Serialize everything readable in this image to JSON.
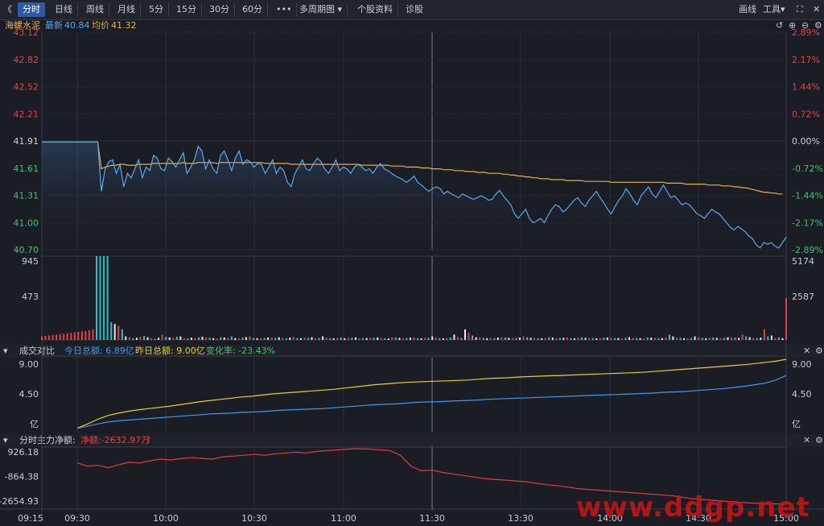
{
  "toolbar": {
    "back": "《",
    "tabs": [
      "分时",
      "日线",
      "周线",
      "月线",
      "5分",
      "15分",
      "30分",
      "60分"
    ],
    "more": "•••",
    "multi_period": "多周期图",
    "stock_info": "个股资料",
    "diagnose": "诊股",
    "right": [
      "画线",
      "工具"
    ]
  },
  "header": {
    "name": "海螺水泥",
    "latest_label": "最新",
    "latest_value": "40.84",
    "avg_label": "均价",
    "avg_value": "41.32"
  },
  "panel2": {
    "title": "成交对比",
    "today": "今日总额: 6.89亿",
    "yesterday": "昨日总额: 9.00亿",
    "change": "变化率: -23.43%"
  },
  "panel3": {
    "title": "分时主力净额:",
    "net": "净额:-2632.97万"
  },
  "watermark": "www.ddgp.net",
  "colors": {
    "price": "#5aa8e8",
    "avg": "#e8b040",
    "up": "#e84040",
    "down": "#3cc46a",
    "cyan": "#28c0c8",
    "today": "#3a9af0",
    "yesterday": "#e8d020",
    "flow": "#e03c3c"
  },
  "chart_data": [
    {
      "type": "line",
      "title": "海螺水泥",
      "x_ticks": [
        "09:15",
        "09:30",
        "10:00",
        "10:30",
        "11:00",
        "11:30",
        "13:30",
        "14:00",
        "14:30",
        "15:00"
      ],
      "y_left_ticks": [
        "43.12",
        "42.82",
        "42.52",
        "42.21",
        "41.91",
        "41.61",
        "41.31",
        "41.00",
        "40.70"
      ],
      "y_right_ticks": [
        "2.89%",
        "2.17%",
        "1.44%",
        "0.72%",
        "0.00%",
        "-0.72%",
        "-1.44%",
        "-2.17%",
        "-2.89%"
      ],
      "ylim": [
        40.7,
        43.12
      ],
      "prev_close": 41.91,
      "series": [
        {
          "name": "最新",
          "values": [
            41.9,
            41.9,
            41.9,
            41.9,
            41.9,
            41.9,
            41.9,
            41.9,
            41.9,
            41.9,
            41.9,
            41.9,
            41.9,
            41.9,
            41.9,
            41.9,
            41.35,
            41.6,
            41.68,
            41.7,
            41.55,
            41.65,
            41.4,
            41.55,
            41.5,
            41.6,
            41.7,
            41.5,
            41.62,
            41.58,
            41.75,
            41.72,
            41.6,
            41.58,
            41.72,
            41.68,
            41.62,
            41.7,
            41.78,
            41.55,
            41.62,
            41.7,
            41.85,
            41.8,
            41.6,
            41.7,
            41.6,
            41.55,
            41.75,
            41.8,
            41.7,
            41.58,
            41.72,
            41.8,
            41.65,
            41.7,
            41.68,
            41.62,
            41.66,
            41.65,
            41.55,
            41.62,
            41.7,
            41.55,
            41.62,
            41.58,
            41.45,
            41.4,
            41.55,
            41.62,
            41.7,
            41.6,
            41.58,
            41.66,
            41.72,
            41.68,
            41.6,
            41.55,
            41.62,
            41.7,
            41.58,
            41.62,
            41.6,
            41.55,
            41.62,
            41.65,
            41.62,
            41.58,
            41.6,
            41.55,
            41.62,
            41.66,
            41.6,
            41.58,
            41.55,
            41.52,
            41.5,
            41.48,
            41.45,
            41.48,
            41.52,
            41.45,
            41.42,
            41.38,
            41.35,
            41.38,
            41.4,
            41.38,
            41.32,
            41.35,
            41.32,
            41.3,
            41.28,
            41.32,
            41.3,
            41.28,
            41.26,
            41.28,
            41.3,
            41.28,
            41.25,
            41.26,
            41.32,
            41.36,
            41.3,
            41.25,
            41.2,
            41.1,
            41.05,
            41.1,
            41.15,
            41.05,
            41.0,
            41.02,
            41.05,
            41.0,
            41.08,
            41.15,
            41.2,
            41.18,
            41.12,
            41.15,
            41.2,
            41.25,
            41.28,
            41.22,
            41.18,
            41.25,
            41.3,
            41.35,
            41.28,
            41.22,
            41.15,
            41.1,
            41.18,
            41.25,
            41.3,
            41.38,
            41.32,
            41.25,
            41.2,
            41.3,
            41.35,
            41.4,
            41.32,
            41.28,
            41.35,
            41.42,
            41.35,
            41.28,
            41.3,
            41.25,
            41.2,
            41.22,
            41.2,
            41.15,
            41.1,
            41.08,
            41.05,
            41.1,
            41.15,
            41.12,
            41.1,
            41.05,
            41.0,
            40.95,
            40.92,
            40.96,
            40.93,
            40.9,
            40.85,
            40.82,
            40.75,
            40.72,
            40.78,
            40.76,
            40.78,
            40.74,
            40.72,
            40.78,
            40.84
          ]
        },
        {
          "name": "均价",
          "values": [
            41.9,
            41.9,
            41.9,
            41.9,
            41.9,
            41.9,
            41.9,
            41.9,
            41.9,
            41.9,
            41.9,
            41.9,
            41.9,
            41.9,
            41.9,
            41.9,
            41.6,
            41.62,
            41.63,
            41.64,
            41.64,
            41.65,
            41.65,
            41.64,
            41.64,
            41.64,
            41.65,
            41.65,
            41.65,
            41.65,
            41.66,
            41.66,
            41.66,
            41.66,
            41.66,
            41.66,
            41.66,
            41.66,
            41.67,
            41.66,
            41.66,
            41.66,
            41.67,
            41.67,
            41.67,
            41.67,
            41.67,
            41.66,
            41.67,
            41.67,
            41.67,
            41.67,
            41.67,
            41.67,
            41.67,
            41.67,
            41.67,
            41.67,
            41.67,
            41.67,
            41.66,
            41.66,
            41.66,
            41.66,
            41.66,
            41.66,
            41.66,
            41.65,
            41.65,
            41.65,
            41.65,
            41.65,
            41.65,
            41.65,
            41.65,
            41.65,
            41.65,
            41.65,
            41.65,
            41.65,
            41.65,
            41.65,
            41.65,
            41.65,
            41.65,
            41.65,
            41.64,
            41.64,
            41.64,
            41.64,
            41.64,
            41.64,
            41.64,
            41.64,
            41.63,
            41.63,
            41.63,
            41.63,
            41.62,
            41.62,
            41.62,
            41.62,
            41.61,
            41.61,
            41.61,
            41.6,
            41.6,
            41.6,
            41.59,
            41.59,
            41.59,
            41.58,
            41.58,
            41.58,
            41.57,
            41.57,
            41.57,
            41.56,
            41.56,
            41.56,
            41.55,
            41.55,
            41.55,
            41.55,
            41.54,
            41.54,
            41.53,
            41.53,
            41.52,
            41.52,
            41.51,
            41.51,
            41.5,
            41.5,
            41.49,
            41.49,
            41.49,
            41.48,
            41.48,
            41.48,
            41.48,
            41.47,
            41.47,
            41.47,
            41.47,
            41.47,
            41.46,
            41.46,
            41.46,
            41.46,
            41.46,
            41.46,
            41.46,
            41.45,
            41.45,
            41.45,
            41.45,
            41.45,
            41.45,
            41.45,
            41.45,
            41.45,
            41.45,
            41.45,
            41.45,
            41.45,
            41.45,
            41.45,
            41.44,
            41.44,
            41.44,
            41.44,
            41.44,
            41.43,
            41.43,
            41.43,
            41.43,
            41.43,
            41.43,
            41.42,
            41.42,
            41.42,
            41.42,
            41.41,
            41.41,
            41.41,
            41.4,
            41.4,
            41.39,
            41.39,
            41.38,
            41.37,
            41.36,
            41.35,
            41.34,
            41.34,
            41.33,
            41.33,
            41.32,
            41.32
          ]
        }
      ]
    },
    {
      "type": "bar",
      "title": "成交量",
      "y_left_ticks": [
        "945",
        "473"
      ],
      "y_right_ticks": [
        "5174",
        "2587"
      ],
      "ylim": [
        0,
        945
      ],
      "values": [
        40,
        45,
        50,
        55,
        60,
        65,
        70,
        75,
        80,
        85,
        90,
        95,
        100,
        110,
        120,
        945,
        945,
        945,
        945,
        200,
        180,
        160,
        120,
        40,
        30,
        20,
        25,
        35,
        45,
        30,
        20,
        15,
        25,
        60,
        35,
        28,
        22,
        35,
        40,
        20,
        18,
        25,
        22,
        30,
        35,
        28,
        24,
        20,
        16,
        30,
        28,
        26,
        40,
        22,
        20,
        28,
        32,
        40,
        24,
        20,
        18,
        22,
        28,
        26,
        24,
        30,
        20,
        18,
        26,
        34,
        22,
        20,
        28,
        24,
        30,
        20,
        22,
        40,
        26,
        20,
        18,
        24,
        28,
        20,
        22,
        26,
        30,
        18,
        20,
        22,
        24,
        26,
        28,
        20,
        18,
        16,
        30,
        28,
        24,
        20,
        22,
        26,
        30,
        20,
        18,
        22,
        24,
        40,
        26,
        20,
        18,
        22,
        28,
        60,
        34,
        24,
        120,
        80,
        50,
        30,
        28,
        24,
        20,
        22,
        18,
        26,
        30,
        28,
        24,
        20,
        22,
        26,
        40,
        30,
        24,
        22,
        20,
        18,
        24,
        30,
        26,
        20,
        22,
        24,
        28,
        20,
        18,
        26,
        30,
        24,
        22,
        20,
        18,
        22,
        26,
        28,
        24,
        20,
        22,
        18,
        26,
        30,
        24,
        22,
        20,
        18,
        28,
        26,
        24,
        20,
        22,
        30,
        60,
        40,
        26,
        24,
        20,
        18,
        22,
        40,
        30,
        24,
        20,
        26,
        28,
        24,
        20,
        22,
        30,
        28,
        26,
        24,
        60,
        40,
        30,
        24,
        20,
        26,
        120,
        40,
        50,
        24,
        30,
        20,
        470
      ]
    },
    {
      "type": "line",
      "title": "成交对比",
      "y_left_ticks": [
        "9.00",
        "4.50",
        "亿"
      ],
      "y_right_ticks": [
        "9.00",
        "4.50",
        "亿"
      ],
      "ylim": [
        0,
        9.0
      ],
      "series": [
        {
          "name": "昨日总额",
          "values": [
            0.05,
            0.6,
            1.2,
            1.7,
            2.0,
            2.25,
            2.45,
            2.6,
            2.75,
            2.9,
            3.1,
            3.3,
            3.5,
            3.65,
            3.8,
            3.95,
            4.1,
            4.2,
            4.35,
            4.5,
            4.6,
            4.7,
            4.8,
            4.9,
            5.0,
            5.1,
            5.25,
            5.4,
            5.55,
            5.7,
            5.8,
            5.9,
            6.0,
            6.05,
            6.1,
            6.15,
            6.2,
            6.25,
            6.3,
            6.4,
            6.5,
            6.55,
            6.6,
            6.7,
            6.75,
            6.8,
            6.85,
            6.9,
            6.95,
            7.0,
            7.05,
            7.1,
            7.15,
            7.2,
            7.25,
            7.3,
            7.4,
            7.5,
            7.6,
            7.7,
            7.8,
            7.9,
            8.0,
            8.1,
            8.2,
            8.3,
            8.45,
            8.6,
            8.75,
            9.0
          ]
        },
        {
          "name": "今日总额",
          "values": [
            0.02,
            0.3,
            0.6,
            0.85,
            1.0,
            1.1,
            1.2,
            1.3,
            1.4,
            1.5,
            1.6,
            1.7,
            1.8,
            1.9,
            1.95,
            2.0,
            2.1,
            2.15,
            2.2,
            2.3,
            2.4,
            2.45,
            2.5,
            2.55,
            2.6,
            2.7,
            2.8,
            2.9,
            3.0,
            3.1,
            3.15,
            3.2,
            3.3,
            3.4,
            3.45,
            3.5,
            3.55,
            3.6,
            3.65,
            3.7,
            3.8,
            3.85,
            3.9,
            3.95,
            4.0,
            4.05,
            4.1,
            4.15,
            4.2,
            4.25,
            4.3,
            4.35,
            4.4,
            4.45,
            4.5,
            4.55,
            4.6,
            4.7,
            4.75,
            4.8,
            4.9,
            5.0,
            5.1,
            5.2,
            5.35,
            5.5,
            5.7,
            5.9,
            6.3,
            6.89
          ]
        }
      ]
    },
    {
      "type": "line",
      "title": "分时主力净额",
      "y_left_ticks": [
        "926.18",
        "-864.38",
        "-2654.93"
      ],
      "ylim": [
        -2654.93,
        926.18
      ],
      "series": [
        {
          "name": "净额",
          "values": [
            0,
            -200,
            -150,
            -300,
            -100,
            50,
            0,
            150,
            250,
            200,
            300,
            350,
            300,
            250,
            400,
            450,
            500,
            550,
            500,
            600,
            650,
            700,
            650,
            750,
            800,
            850,
            900,
            926,
            900,
            850,
            800,
            500,
            -200,
            -500,
            -450,
            -600,
            -700,
            -800,
            -900,
            -1000,
            -1050,
            -1100,
            -1150,
            -1200,
            -1300,
            -1400,
            -1450,
            -1550,
            -1650,
            -1700,
            -1750,
            -1800,
            -1850,
            -1900,
            -1950,
            -2000,
            -2050,
            -2100,
            -2200,
            -2300,
            -2350,
            -2400,
            -2450,
            -2500,
            -2550,
            -2600,
            -2620,
            -2630,
            -2633
          ]
        }
      ]
    }
  ]
}
